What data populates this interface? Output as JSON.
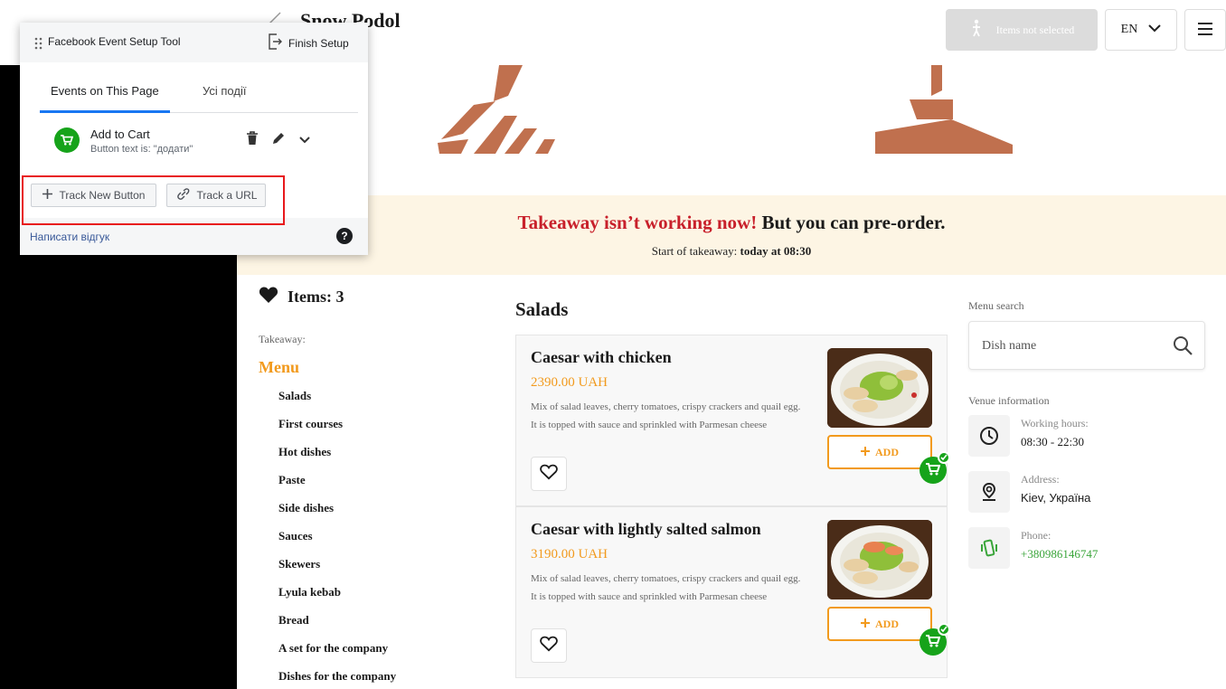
{
  "header": {
    "venue_title": "Snow Podol",
    "items_not_selected": "Items not selected",
    "language": "EN"
  },
  "notice": {
    "closed_text": "Takeaway isn’t working now!",
    "preorder_text": "But you can pre-order.",
    "start_label": "Start of takeaway:",
    "start_value": "today at 08:30"
  },
  "nav": {
    "items_count": "Items: 3",
    "takeaway_label": "Takeaway:",
    "menu_heading": "Menu",
    "categories": [
      "Salads",
      "First courses",
      "Hot dishes",
      "Paste",
      "Side dishes",
      "Sauces",
      "Skewers",
      "Lyula kebab",
      "Bread",
      "A set for the company",
      "Dishes for the company"
    ]
  },
  "main": {
    "section_title": "Salads",
    "add_label": "ADD",
    "dishes": [
      {
        "name": "Caesar with chicken",
        "price": "2390.00 UAH",
        "description": "Mix of salad leaves, cherry tomatoes, crispy crackers and quail egg. It is topped with sauce and sprinkled with Parmesan cheese"
      },
      {
        "name": "Caesar with lightly salted salmon",
        "price": "3190.00 UAH",
        "description": "Mix of salad leaves, cherry tomatoes, crispy crackers and quail egg. It is topped with sauce and sprinkled with Parmesan cheese"
      }
    ]
  },
  "sidebar": {
    "search_label": "Menu search",
    "search_placeholder": "Dish name",
    "venue_info_label": "Venue information",
    "hours_title": "Working hours:",
    "hours_value": "08:30 - 22:30",
    "address_title": "Address:",
    "address_value": "Kiev, Україна",
    "phone_title": "Phone:",
    "phone_value": "+380986146747"
  },
  "fb_tool": {
    "title": "Facebook Event Setup Tool",
    "finish_setup": "Finish Setup",
    "tab_events_page": "Events on This Page",
    "tab_all_events": "Усі події",
    "event_title": "Add to Cart",
    "event_subtitle": "Button text is: \"додати\"",
    "track_new_button": "Track New Button",
    "track_url": "Track a URL",
    "feedback": "Написати відгук",
    "help": "?"
  },
  "colors": {
    "accent_orange": "#f29a1d",
    "notice_red": "#c8202b",
    "cart_green": "#16a31a",
    "fb_blue": "#1877f2",
    "highlight_red": "#e8191c"
  }
}
